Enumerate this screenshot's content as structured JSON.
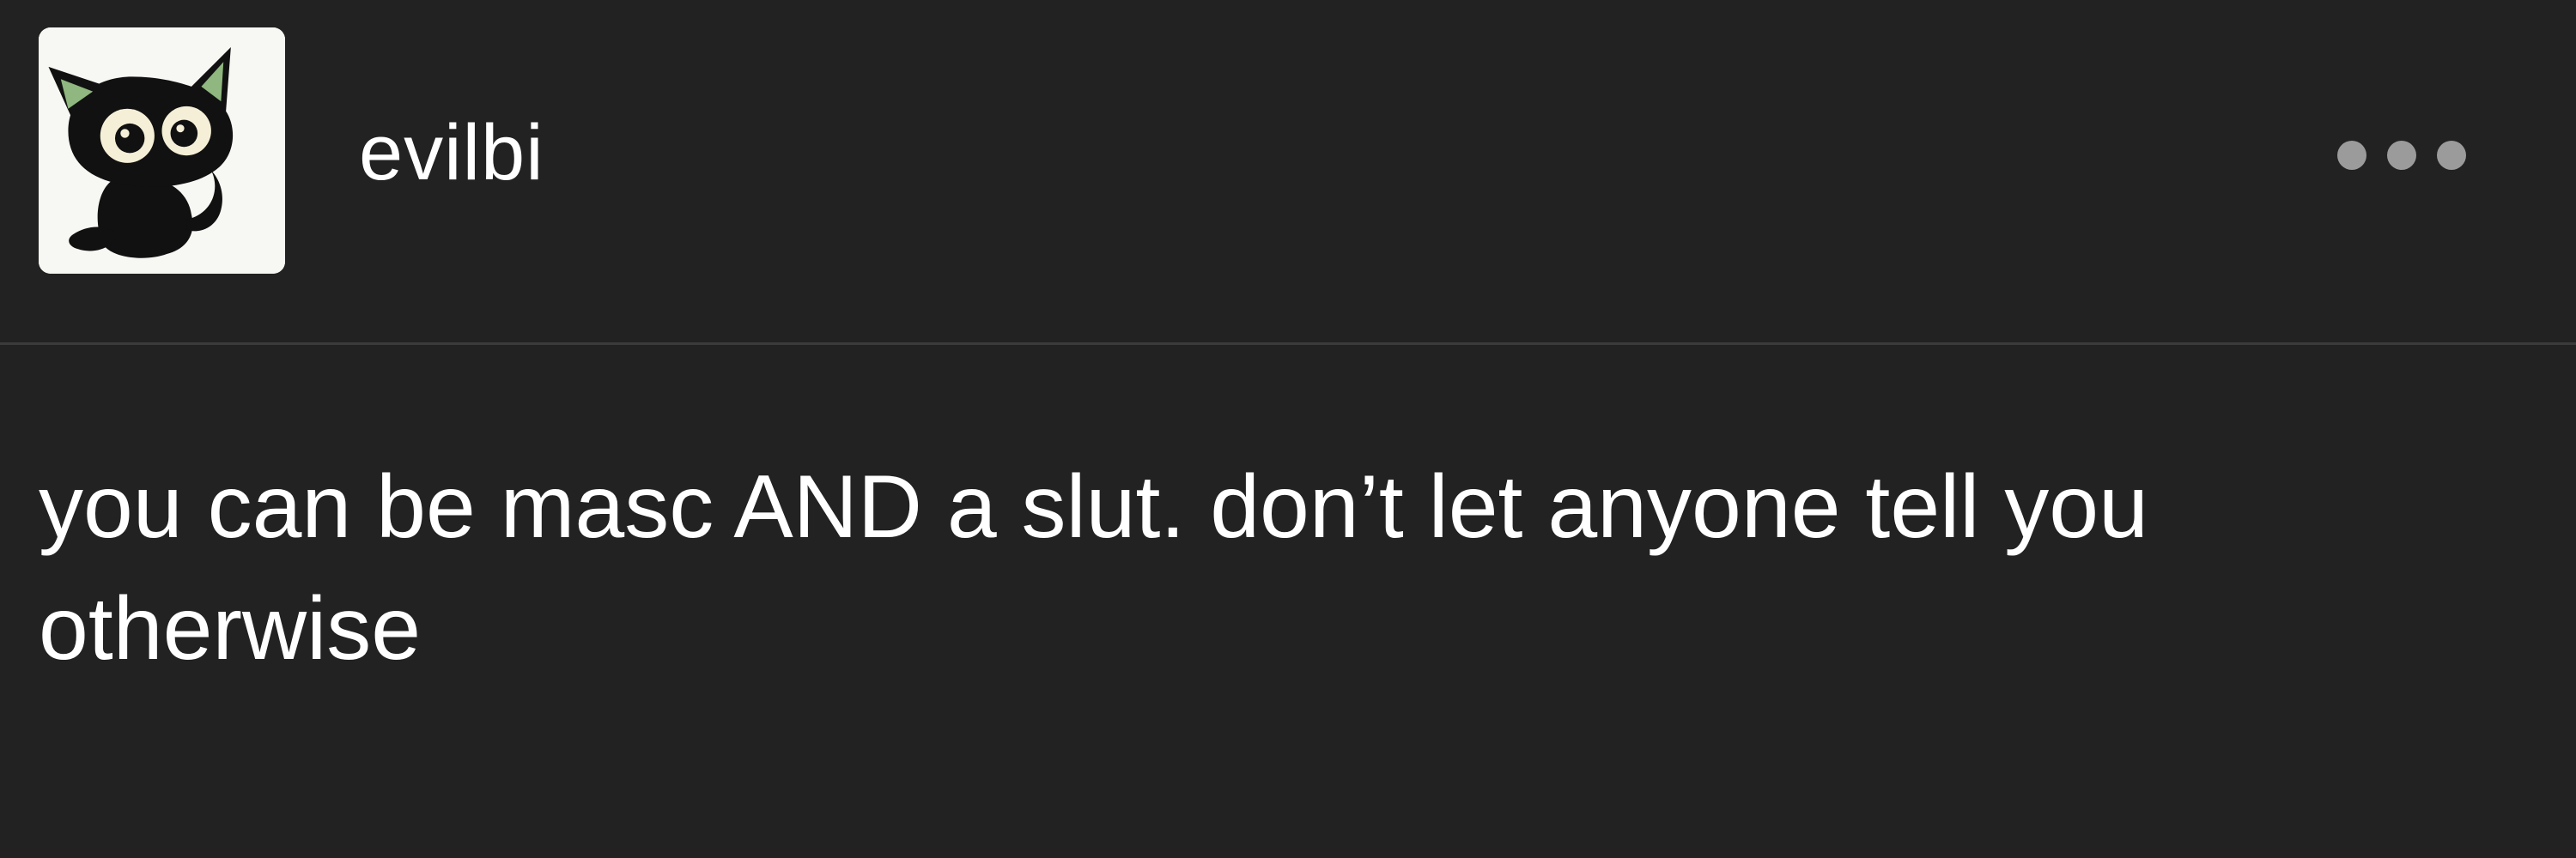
{
  "post": {
    "author": {
      "username": "evilbi",
      "avatar_icon": "black-cat-icon"
    },
    "menu_icon": "more-options-icon",
    "body_text": "you can be masc AND a slut. don’t let anyone tell you otherwise"
  },
  "colors": {
    "background": "#222222",
    "text": "#ffffff",
    "divider": "#3b3b3b",
    "menu_dots": "#9b9b9b",
    "avatar_bg": "#f7f7f3"
  }
}
